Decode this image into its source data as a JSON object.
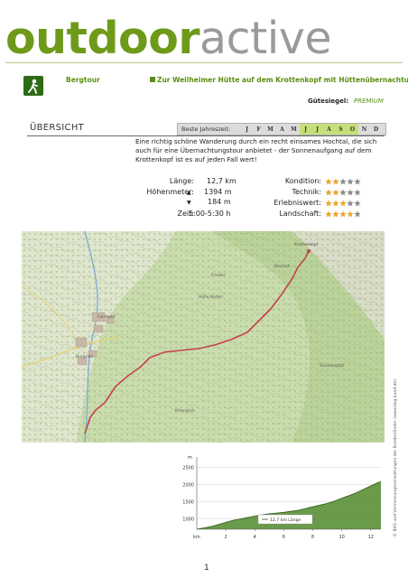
{
  "header": {
    "logo_word_1": "outdoor",
    "logo_word_2": "active",
    "category": "Bergtour",
    "title": "Zur Weilheimer Hütte auf dem Krottenkopf mit Hüttenübernachtung",
    "seal_label": "Gütesiegel:",
    "seal_value": "PREMIUM"
  },
  "overview": {
    "heading": "ÜBERSICHT",
    "season_label": "Beste Jahreszeit:",
    "months": [
      {
        "letter": "J",
        "active": false
      },
      {
        "letter": "F",
        "active": false
      },
      {
        "letter": "M",
        "active": false
      },
      {
        "letter": "A",
        "active": false
      },
      {
        "letter": "M",
        "active": false
      },
      {
        "letter": "J",
        "active": true
      },
      {
        "letter": "J",
        "active": true
      },
      {
        "letter": "A",
        "active": true
      },
      {
        "letter": "S",
        "active": true
      },
      {
        "letter": "O",
        "active": true
      },
      {
        "letter": "N",
        "active": false
      },
      {
        "letter": "D",
        "active": false
      }
    ],
    "description": "Eine richtig schöne Wanderung durch ein recht einsames Hochtal, die sich auch für eine Übernachtungstour anbietet - der Sonnenaufgang auf dem Krottenkopf ist es auf jeden Fall wert!",
    "stats": {
      "length_label": "Länge:",
      "length_value": "12,7 km",
      "elevation_label": "Höhenmeter:",
      "ascent_value": "1394 m",
      "descent_value": "184 m",
      "time_label": "Zeit:",
      "time_value": "5:00-5:30 h"
    },
    "ratings": [
      {
        "label": "Kondition:",
        "score": 2,
        "max": 5
      },
      {
        "label": "Technik:",
        "score": 2,
        "max": 5
      },
      {
        "label": "Erlebniswert:",
        "score": 3,
        "max": 5
      },
      {
        "label": "Landschaft:",
        "score": 4,
        "max": 5
      }
    ],
    "colors": {
      "star_on": "#e8a52a",
      "star_off": "#8a8a8a",
      "accent": "#5a8f12",
      "month_on": "#c6df7a"
    }
  },
  "map": {
    "labels": [
      "Krottenkopf",
      "Bischof",
      "Sonnenspitz",
      "Frieder",
      "Farchant",
      "Burgrain",
      "Kreuzjoch",
      "Hohe Kisten"
    ]
  },
  "side_note": "© BKG und Vermessungsverwaltungen der Bundesländer (www.bkg.bund.de)",
  "profile": {
    "y_unit": "m",
    "y_ticks": [
      "2500",
      "2000",
      "1500",
      "1000"
    ],
    "x_unit": "km",
    "x_ticks": [
      "2",
      "4",
      "6",
      "8",
      "10",
      "12"
    ],
    "legend": "12,7 km Länge"
  },
  "chart_data": {
    "type": "area",
    "x": [
      0,
      0.5,
      1,
      1.5,
      2,
      2.5,
      3,
      3.5,
      4,
      4.5,
      5,
      5.5,
      6,
      6.5,
      7,
      7.5,
      8,
      8.5,
      9,
      9.5,
      10,
      10.5,
      11,
      11.5,
      12,
      12.4,
      12.7
    ],
    "y": [
      700,
      740,
      780,
      840,
      900,
      960,
      1000,
      1040,
      1080,
      1120,
      1150,
      1170,
      1190,
      1220,
      1250,
      1300,
      1350,
      1400,
      1450,
      1520,
      1600,
      1680,
      1760,
      1860,
      1960,
      2040,
      2086
    ],
    "xlabel": "km",
    "ylabel": "m",
    "ylim": [
      700,
      2800
    ],
    "xlim": [
      0,
      12.7
    ]
  },
  "page": {
    "number": "1"
  }
}
